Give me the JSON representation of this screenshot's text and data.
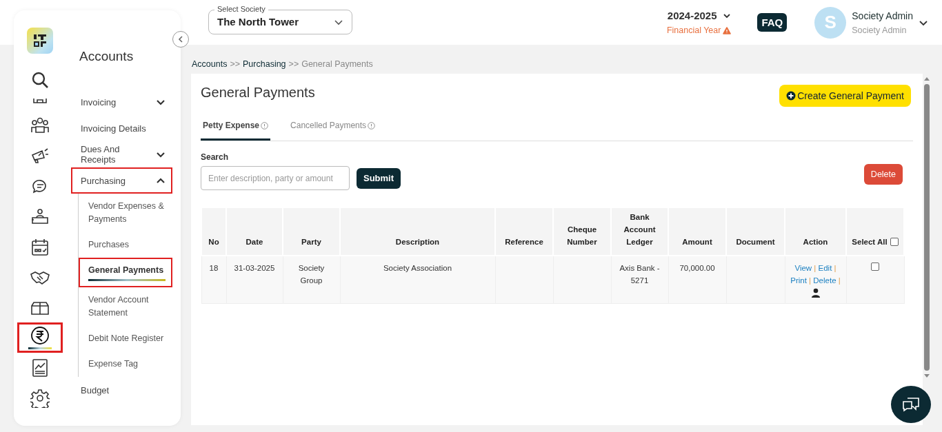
{
  "sidebar": {
    "rail_items": [
      {
        "selected": false,
        "highlighted": false
      },
      {
        "selected": false,
        "highlighted": false
      },
      {
        "selected": false,
        "highlighted": false
      },
      {
        "selected": false,
        "highlighted": false
      },
      {
        "selected": false,
        "highlighted": false
      },
      {
        "selected": false,
        "highlighted": false
      },
      {
        "selected": false,
        "highlighted": false
      },
      {
        "selected": false,
        "highlighted": false
      },
      {
        "selected": false,
        "highlighted": false
      },
      {
        "selected": true,
        "highlighted": true
      },
      {
        "selected": false,
        "highlighted": false
      },
      {
        "selected": false,
        "highlighted": false
      }
    ],
    "title": "Accounts",
    "menu": [
      {
        "label": "Invoicing",
        "expanded": false,
        "highlighted": false
      },
      {
        "label": "Invoicing Details",
        "highlighted": false
      },
      {
        "label": "Dues And Receipts",
        "expanded": false,
        "highlighted": false
      },
      {
        "label": "Purchasing",
        "expanded": true,
        "highlighted": true,
        "children": [
          {
            "label": "Vendor Expenses & Payments",
            "selected": false,
            "highlighted": false
          },
          {
            "label": "Purchases",
            "selected": false,
            "highlighted": false
          },
          {
            "label": "General Payments",
            "selected": true,
            "highlighted": true
          },
          {
            "label": "Vendor Account Statement",
            "selected": false,
            "highlighted": false
          },
          {
            "label": "Debit Note Register",
            "selected": false,
            "highlighted": false
          },
          {
            "label": "Expense Tag",
            "selected": false,
            "highlighted": false
          }
        ]
      },
      {
        "label": "Budget",
        "highlighted": false
      }
    ]
  },
  "header": {
    "society_select": {
      "label": "Select Society",
      "value": "The North Tower"
    },
    "year": "2024-2025",
    "year_note": "Financial Year",
    "faq": "FAQ",
    "user": {
      "initial": "S",
      "name": "Society Admin",
      "role": "Society Admin"
    }
  },
  "breadcrumb": [
    {
      "label": "Accounts",
      "kind": "link"
    },
    {
      "label": ">>",
      "kind": "separator"
    },
    {
      "label": "Purchasing",
      "kind": "link"
    },
    {
      "label": ">>",
      "kind": "separator"
    },
    {
      "label": "General Payments",
      "kind": "current"
    }
  ],
  "page": {
    "title": "General Payments",
    "create_button": "Create General Payment",
    "tabs": [
      {
        "label": "Petty Expense",
        "selected": true
      },
      {
        "label": "Cancelled Payments",
        "selected": false
      }
    ],
    "search": {
      "label": "Search",
      "placeholder": "Enter description, party or amount",
      "submit": "Submit"
    },
    "delete_button": "Delete"
  },
  "table": {
    "columns": [
      "No",
      "Date",
      "Party",
      "Description",
      "Reference",
      "Cheque Number",
      "Bank Account Ledger",
      "Amount",
      "Document",
      "Action",
      "Select All"
    ],
    "select_all_checked": false,
    "rows": [
      {
        "cells": [
          "18",
          "31-03-2025",
          "Society Group",
          "Society Association",
          "",
          "",
          "Axis Bank - 5271",
          "70,000.00",
          ""
        ],
        "actions": [
          {
            "label": "View",
            "kind": "link"
          },
          {
            "label": "|",
            "kind": "separator"
          },
          {
            "label": "Edit",
            "kind": "link"
          },
          {
            "label": "|",
            "kind": "separator"
          },
          {
            "label": "Print",
            "kind": "link"
          },
          {
            "label": "|",
            "kind": "separator"
          },
          {
            "label": "Delete",
            "kind": "link"
          },
          {
            "label": "|",
            "kind": "separator"
          }
        ],
        "checked": false
      }
    ]
  }
}
